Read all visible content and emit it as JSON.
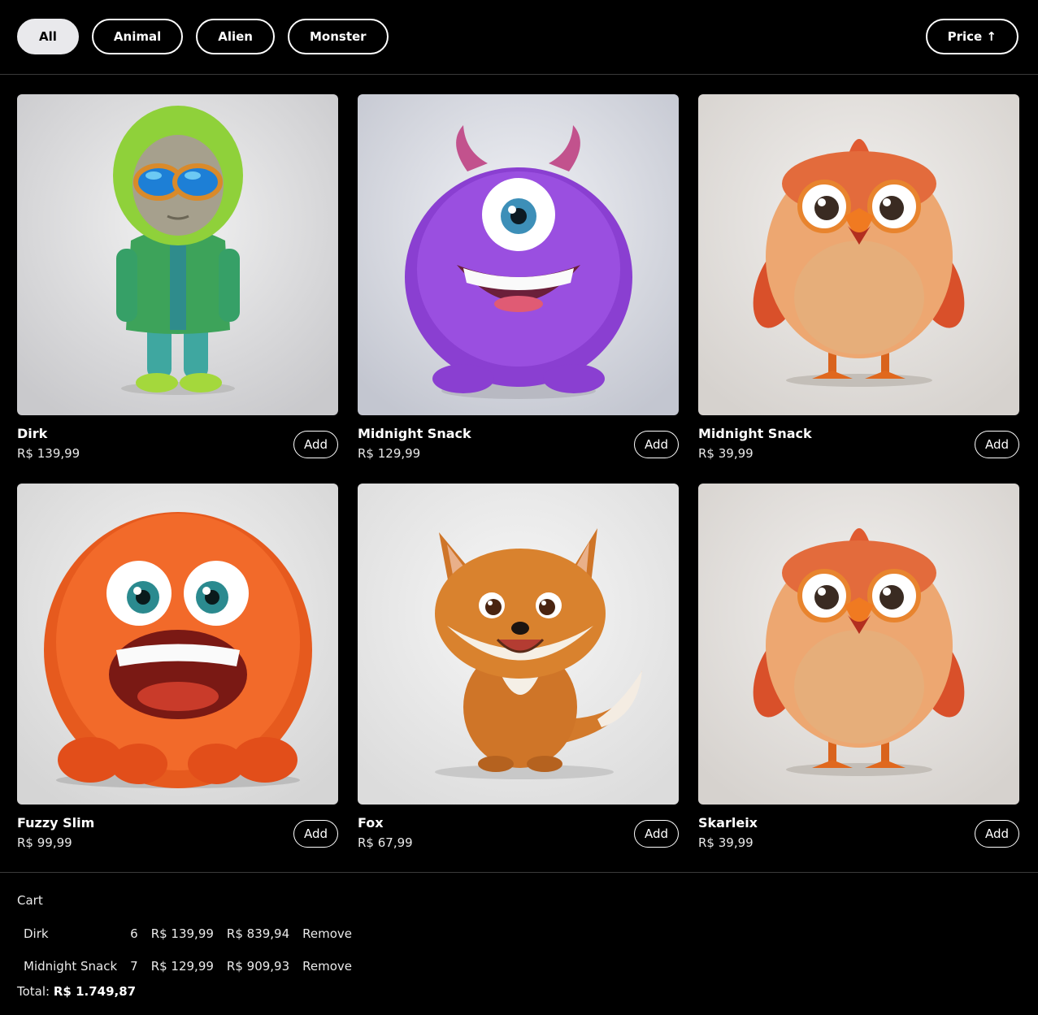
{
  "filters": [
    {
      "label": "All",
      "active": true
    },
    {
      "label": "Animal",
      "active": false
    },
    {
      "label": "Alien",
      "active": false
    },
    {
      "label": "Monster",
      "active": false
    }
  ],
  "sort": {
    "label": "Price ↑"
  },
  "products": [
    {
      "name": "Dirk",
      "price": "R$ 139,99",
      "add_label": "Add",
      "image": "alien-in-hoodie"
    },
    {
      "name": "Midnight Snack",
      "price": "R$ 129,99",
      "add_label": "Add",
      "image": "purple-cyclops-monster"
    },
    {
      "name": "Midnight Snack",
      "price": "R$ 39,99",
      "add_label": "Add",
      "image": "orange-chick"
    },
    {
      "name": "Fuzzy Slim",
      "price": "R$ 99,99",
      "add_label": "Add",
      "image": "orange-furry-monster"
    },
    {
      "name": "Fox",
      "price": "R$ 67,99",
      "add_label": "Add",
      "image": "cartoon-fox"
    },
    {
      "name": "Skarleix",
      "price": "R$ 39,99",
      "add_label": "Add",
      "image": "orange-chick"
    }
  ],
  "cart": {
    "title": "Cart",
    "items": [
      {
        "name": "Dirk",
        "qty": "6",
        "unit": "R$ 139,99",
        "subtotal": "R$ 839,94",
        "remove_label": "Remove"
      },
      {
        "name": "Midnight Snack",
        "qty": "7",
        "unit": "R$ 129,99",
        "subtotal": "R$ 909,93",
        "remove_label": "Remove"
      }
    ],
    "total_label": "Total:",
    "total_value": "R$ 1.749,87"
  }
}
